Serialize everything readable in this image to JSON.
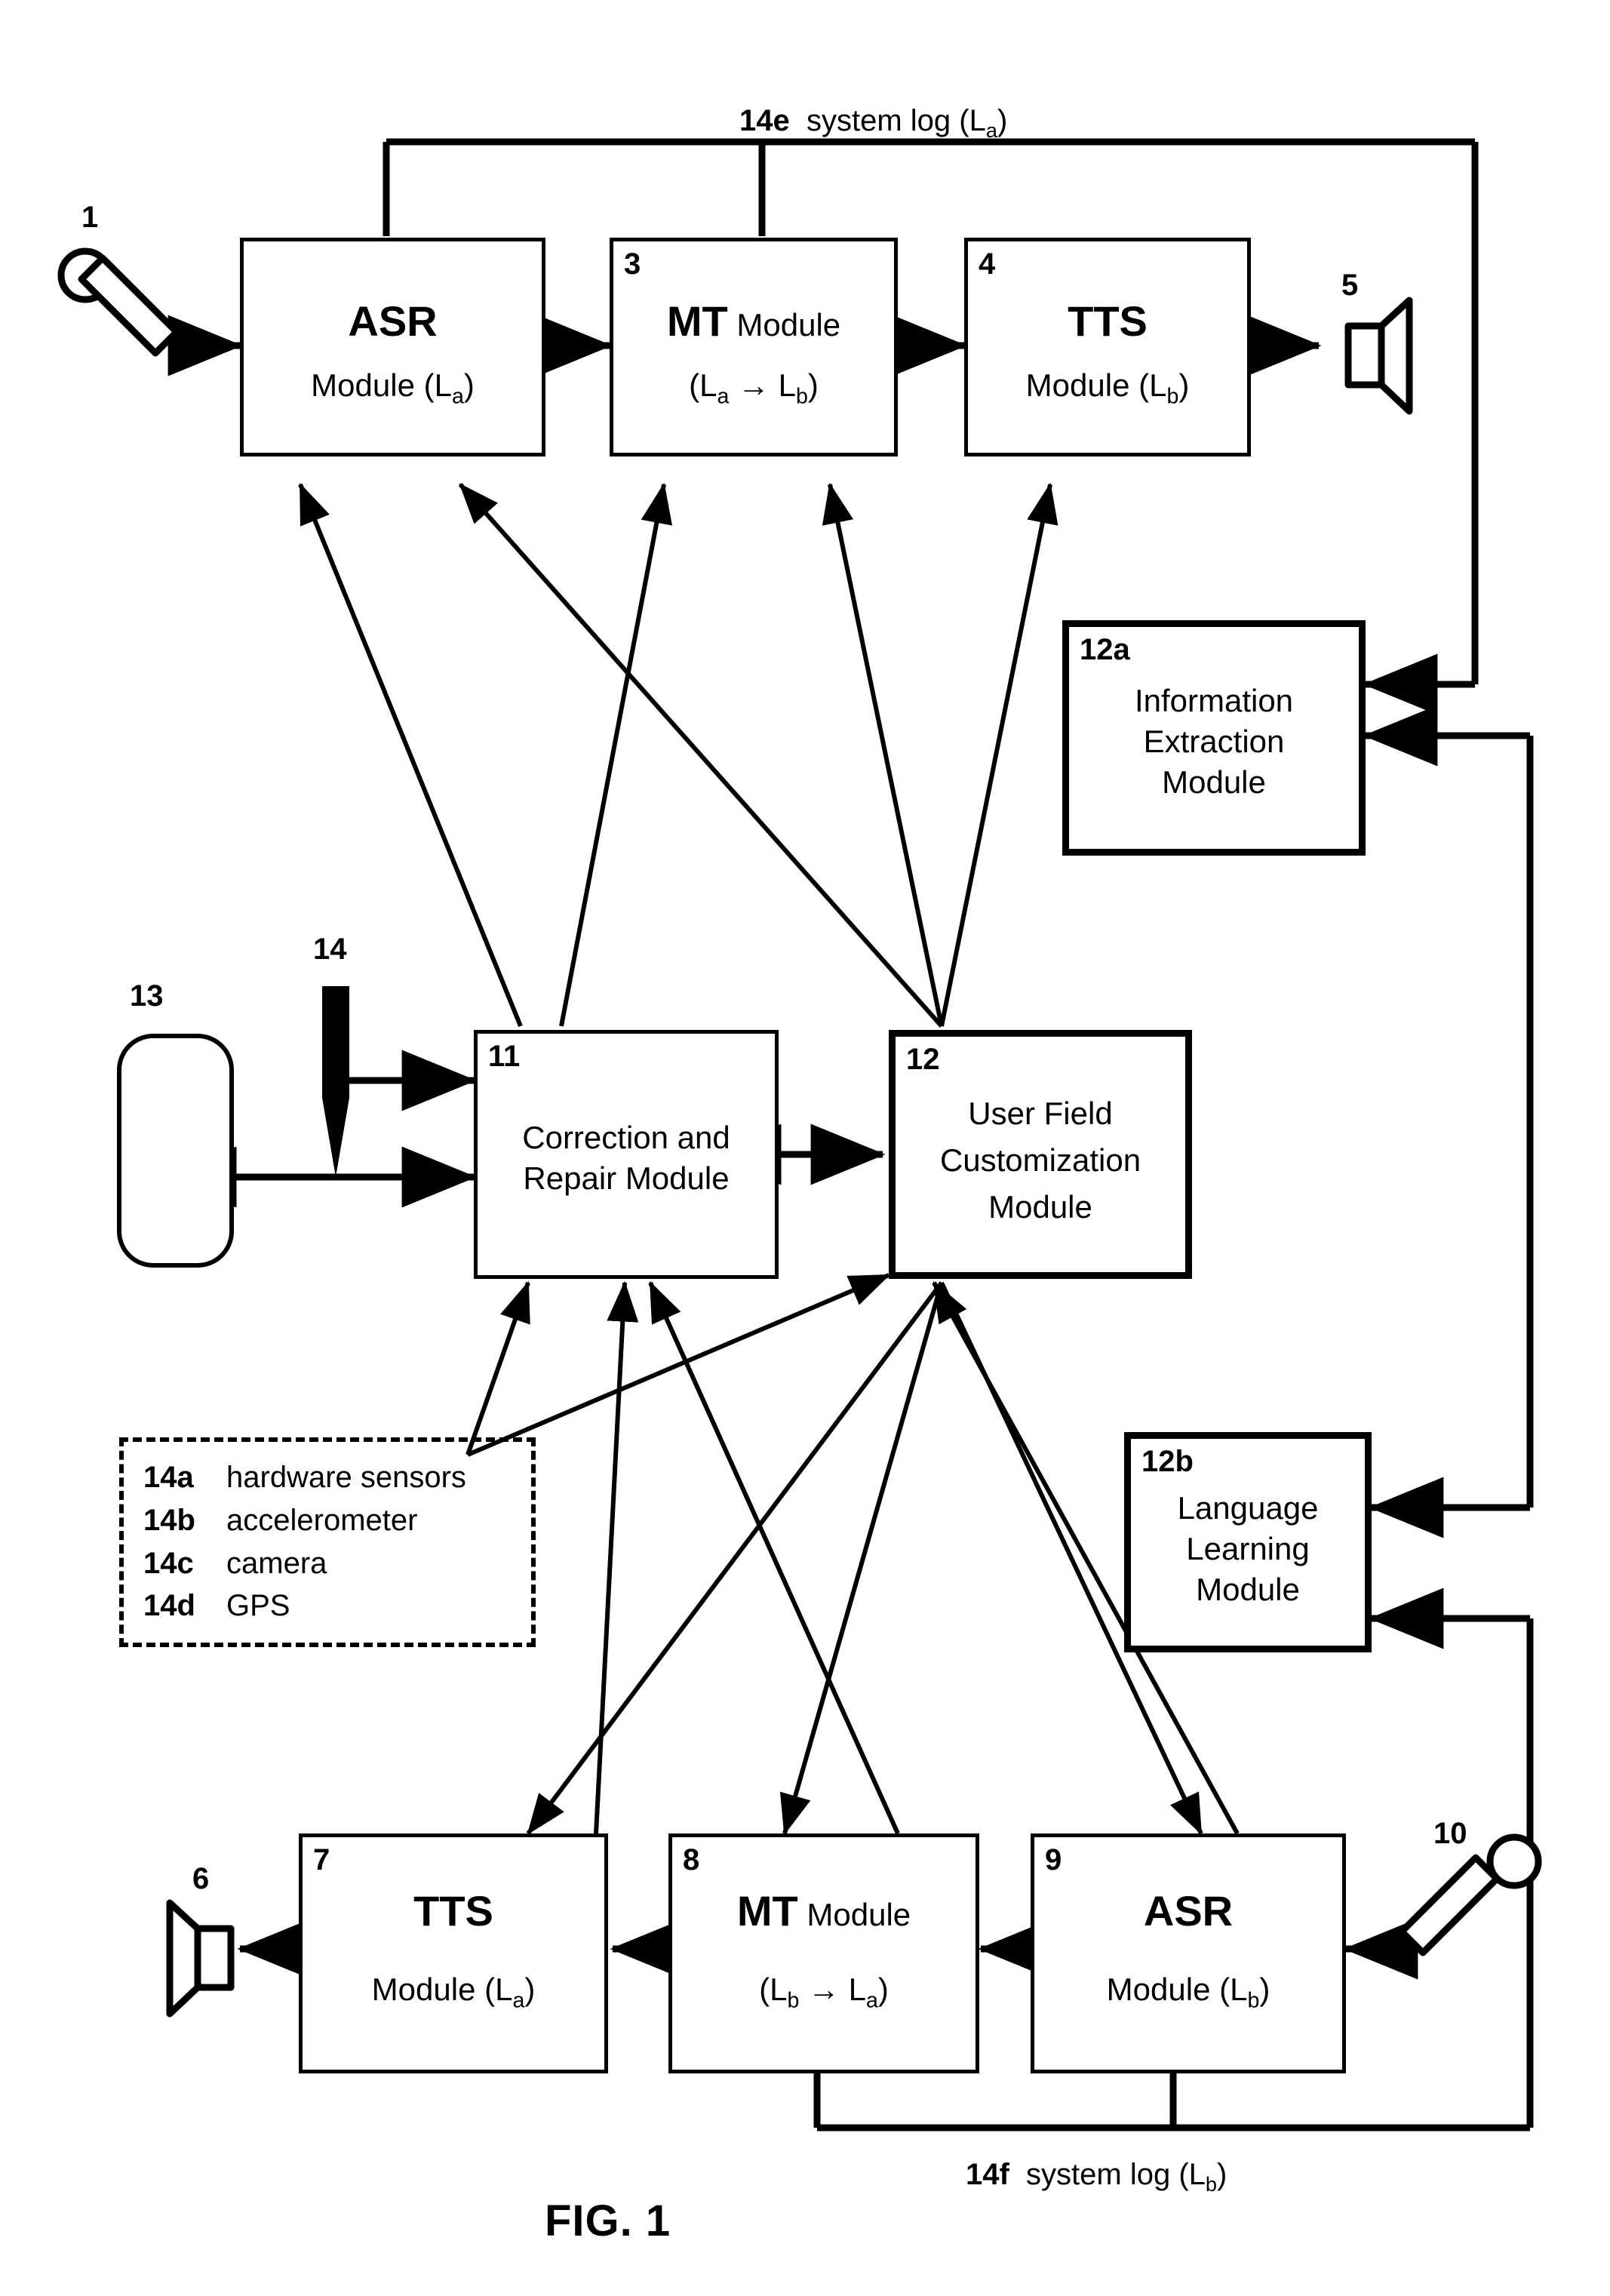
{
  "figure": {
    "caption": "FIG. 1",
    "domain": "patent block diagram"
  },
  "top_log": {
    "ref": "14e",
    "text": "system log (L",
    "sub": "a",
    "text_end": ")"
  },
  "bottom_log": {
    "ref": "14f",
    "text": "system log (L",
    "sub": "b",
    "text_end": ")"
  },
  "boxes": {
    "asr_a": {
      "num": "",
      "line1": "ASR",
      "line2_pre": "Module (L",
      "line2_sub": "a",
      "line2_post": ")"
    },
    "mt_ab": {
      "num": "3",
      "line1_bold": "MT",
      "line1_rest": " Module",
      "line2_pre": "(L",
      "line2_sub1": "a",
      "line2_mid": " → L",
      "line2_sub2": "b",
      "line2_post": ")"
    },
    "tts_b": {
      "num": "4",
      "line1": "TTS",
      "line2_pre": "Module (L",
      "line2_sub": "b",
      "line2_post": ")"
    },
    "info_extraction": {
      "num": "12a",
      "line1": "Information",
      "line2": "Extraction",
      "line3": "Module"
    },
    "correction_repair": {
      "num": "11",
      "line1": "Correction and",
      "line2": "Repair Module"
    },
    "user_field_custom": {
      "num": "12",
      "line1": "User Field",
      "line2": "Customization",
      "line3": "Module"
    },
    "language_learning": {
      "num": "12b",
      "line1": "Language",
      "line2": "Learning",
      "line3": "Module"
    },
    "tts_a": {
      "num": "7",
      "line1": "TTS",
      "line2_pre": "Module (L",
      "line2_sub": "a",
      "line2_post": ")"
    },
    "mt_ba": {
      "num": "8",
      "line1_bold": "MT",
      "line1_rest": " Module",
      "line2_pre": "(L",
      "line2_sub1": "b",
      "line2_mid": " → L",
      "line2_sub2": "a",
      "line2_post": ")"
    },
    "asr_b": {
      "num": "9",
      "line1": "ASR",
      "line2_pre": "Module (L",
      "line2_sub": "b",
      "line2_post": ")"
    }
  },
  "refs": {
    "mic_in_a": "1",
    "speaker_out_b": "5",
    "speaker_out_a": "6",
    "mic_in_b": "10",
    "display_device": "13",
    "stylus": "14"
  },
  "sensor_box": {
    "items": [
      {
        "code": "14a",
        "label": "hardware sensors"
      },
      {
        "code": "14b",
        "label": "accelerometer"
      },
      {
        "code": "14c",
        "label": "camera"
      },
      {
        "code": "14d",
        "label": "GPS"
      }
    ]
  },
  "colors": {
    "ink": "#000000",
    "paper": "#ffffff"
  },
  "chart_data": {
    "type": "diagram",
    "title": "FIG. 1 — Speech translation system block diagram",
    "nodes": [
      {
        "id": "1",
        "label": "microphone (input L_a)",
        "shape": "microphone"
      },
      {
        "id": "2",
        "label": "ASR Module (L_a)",
        "shape": "rect"
      },
      {
        "id": "3",
        "label": "MT Module (L_a -> L_b)",
        "shape": "rect"
      },
      {
        "id": "4",
        "label": "TTS Module (L_b)",
        "shape": "rect"
      },
      {
        "id": "5",
        "label": "speaker (output L_b)",
        "shape": "speaker"
      },
      {
        "id": "6",
        "label": "speaker (output L_a)",
        "shape": "speaker"
      },
      {
        "id": "7",
        "label": "TTS Module (L_a)",
        "shape": "rect"
      },
      {
        "id": "8",
        "label": "MT Module (L_b -> L_a)",
        "shape": "rect"
      },
      {
        "id": "9",
        "label": "ASR Module (L_b)",
        "shape": "rect"
      },
      {
        "id": "10",
        "label": "microphone (input L_b)",
        "shape": "microphone"
      },
      {
        "id": "11",
        "label": "Correction and Repair Module",
        "shape": "rect"
      },
      {
        "id": "12",
        "label": "User Field Customization Module",
        "shape": "rect-thick"
      },
      {
        "id": "12a",
        "label": "Information Extraction Module",
        "shape": "rect-thick"
      },
      {
        "id": "12b",
        "label": "Language Learning Module",
        "shape": "rect-thick"
      },
      {
        "id": "13",
        "label": "display / touchscreen",
        "shape": "rounded-rect"
      },
      {
        "id": "14",
        "label": "stylus",
        "shape": "pen"
      },
      {
        "id": "14a-14d",
        "label": "hardware sensors, accelerometer, camera, GPS",
        "shape": "dashed-rect"
      },
      {
        "id": "14e",
        "label": "system log (L_a)",
        "shape": "bus"
      },
      {
        "id": "14f",
        "label": "system log (L_b)",
        "shape": "bus"
      }
    ],
    "edges": [
      {
        "from": "1",
        "to": "2",
        "dir": "one-way"
      },
      {
        "from": "2",
        "to": "3",
        "dir": "one-way"
      },
      {
        "from": "3",
        "to": "4",
        "dir": "one-way"
      },
      {
        "from": "4",
        "to": "5",
        "dir": "one-way"
      },
      {
        "from": "11",
        "to": "2",
        "dir": "one-way"
      },
      {
        "from": "12",
        "to": "2",
        "dir": "one-way"
      },
      {
        "from": "11",
        "to": "3",
        "dir": "one-way"
      },
      {
        "from": "12",
        "to": "3",
        "dir": "one-way"
      },
      {
        "from": "12",
        "to": "4",
        "dir": "one-way"
      },
      {
        "from": "11",
        "to": "12",
        "dir": "two-way"
      },
      {
        "from": "13",
        "to": "11",
        "dir": "two-way"
      },
      {
        "from": "14",
        "to": "11",
        "dir": "one-way"
      },
      {
        "from": "14a-14d",
        "to": "11",
        "dir": "one-way"
      },
      {
        "from": "14a-14d",
        "to": "12",
        "dir": "one-way"
      },
      {
        "from": "12",
        "to": "7",
        "dir": "one-way"
      },
      {
        "from": "12",
        "to": "8",
        "dir": "one-way"
      },
      {
        "from": "12",
        "to": "9",
        "dir": "one-way"
      },
      {
        "from": "7",
        "to": "11",
        "dir": "one-way"
      },
      {
        "from": "8",
        "to": "11",
        "dir": "one-way"
      },
      {
        "from": "9",
        "to": "11",
        "dir": "one-way"
      },
      {
        "from": "10",
        "to": "9",
        "dir": "one-way"
      },
      {
        "from": "9",
        "to": "8",
        "dir": "one-way"
      },
      {
        "from": "8",
        "to": "7",
        "dir": "one-way"
      },
      {
        "from": "7",
        "to": "6",
        "dir": "one-way"
      },
      {
        "from": "14e",
        "to": "12a",
        "dir": "one-way"
      },
      {
        "from": "14e",
        "to": "12b",
        "dir": "one-way"
      },
      {
        "from": "14f",
        "to": "12a",
        "dir": "one-way"
      },
      {
        "from": "14f",
        "to": "12b",
        "dir": "one-way"
      }
    ]
  }
}
